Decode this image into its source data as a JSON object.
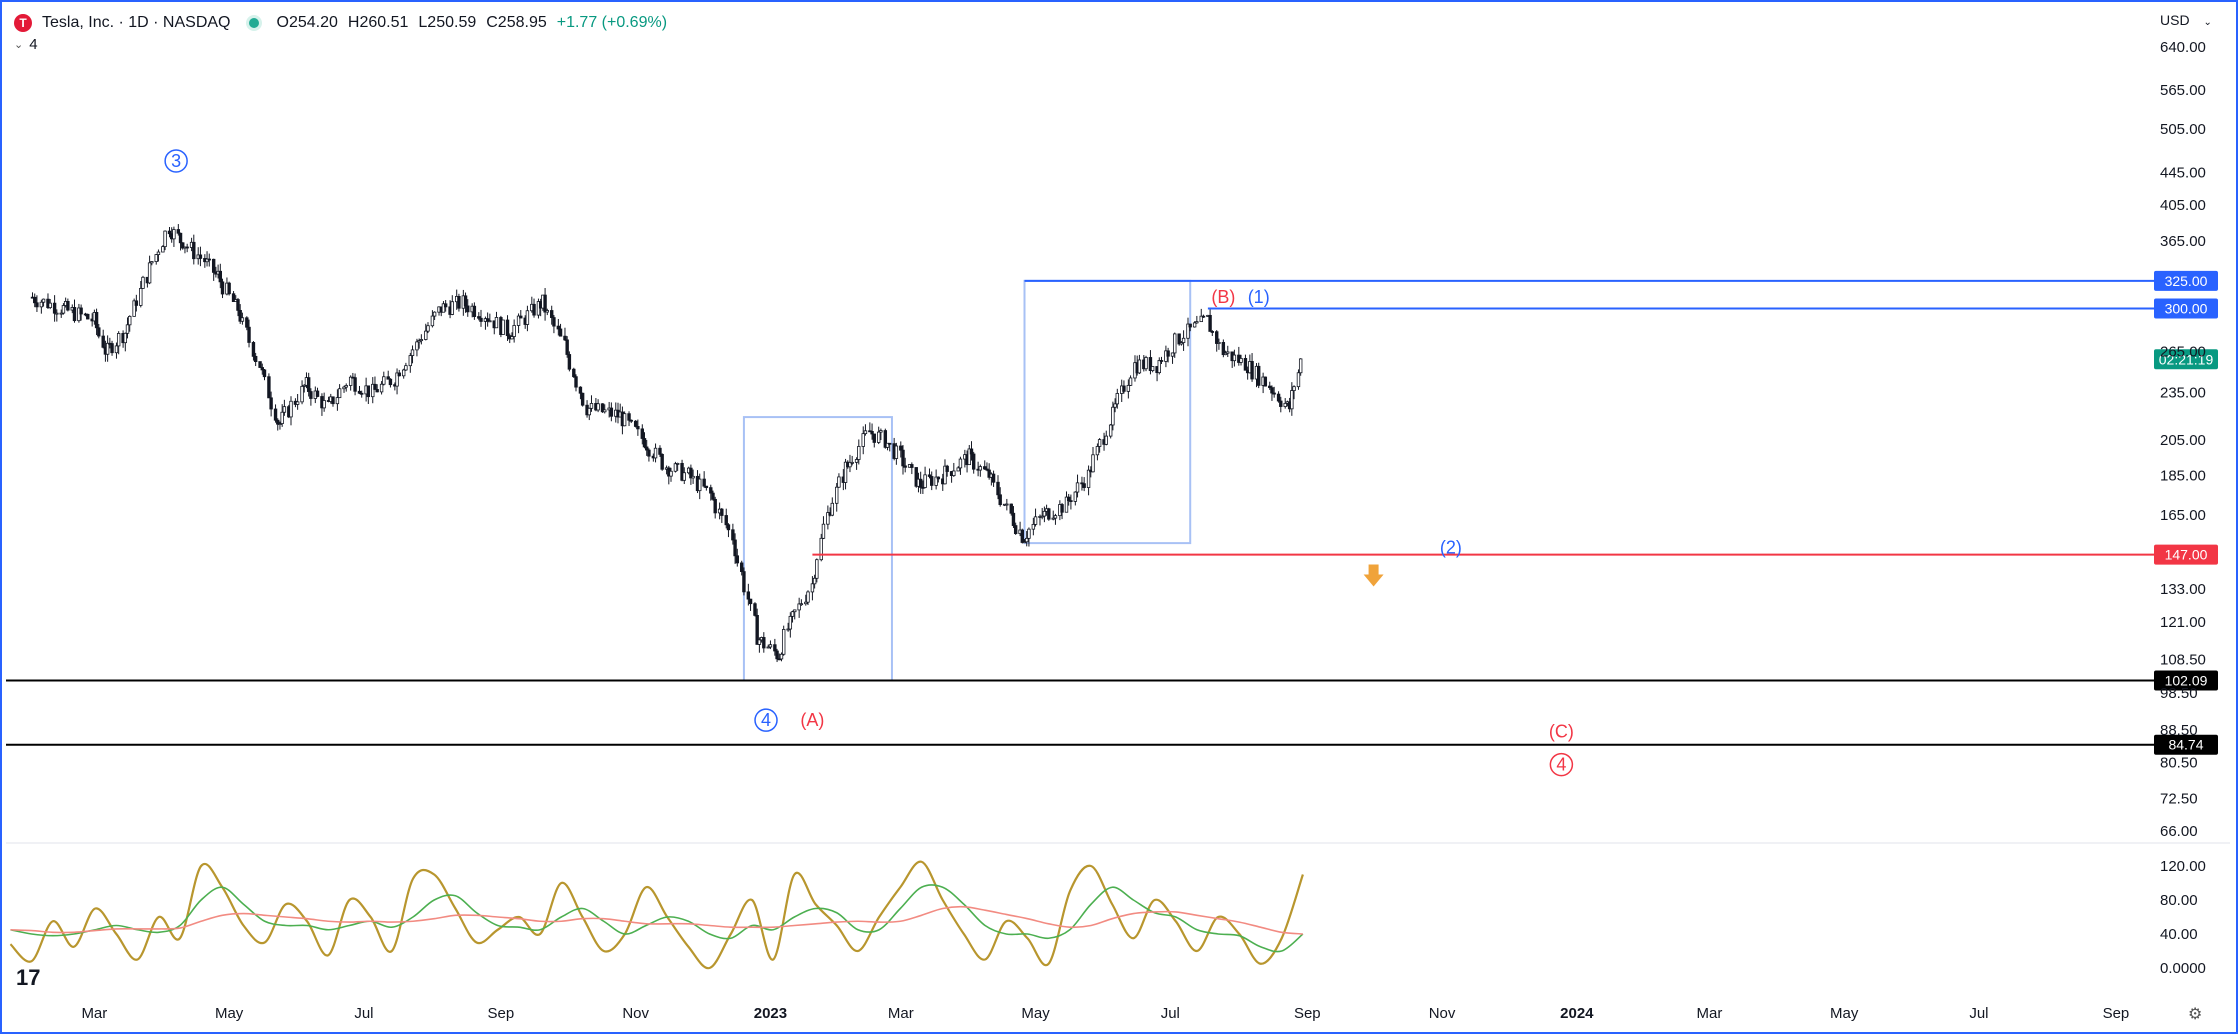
{
  "header": {
    "logo_letter": "T",
    "symbol_title": "Tesla, Inc. · 1D · NASDAQ",
    "open_label": "O",
    "open": "254.20",
    "high_label": "H",
    "high": "260.51",
    "low_label": "L",
    "low": "250.59",
    "close_label": "C",
    "close": "258.95",
    "change": "+1.77 (+0.69%)",
    "indicator_count": "4",
    "currency": "USD"
  },
  "colors": {
    "accent": "#2962ff",
    "up": "#089981",
    "down": "#f23645",
    "candle": "#131722",
    "fast_line": "#b8962e",
    "mid_line": "#4caf50",
    "slow_line": "#f28b82"
  },
  "chart_data": [
    {
      "type": "candlestick",
      "title": "Tesla, Inc. · 1D · NASDAQ",
      "y_scale": "log",
      "ylim": [
        62,
        700
      ],
      "y_ticks": [
        "640.00",
        "565.00",
        "505.00",
        "445.00",
        "405.00",
        "365.00",
        "265.00",
        "235.00",
        "205.00",
        "185.00",
        "165.00",
        "133.00",
        "121.00",
        "108.50",
        "98.50",
        "88.50",
        "80.50",
        "72.50",
        "66.00"
      ],
      "x_ticks": [
        "Mar",
        "May",
        "Jul",
        "Sep",
        "Nov",
        "2023",
        "Mar",
        "May",
        "Jul",
        "Sep",
        "Nov",
        "2024",
        "Mar",
        "May",
        "Jul",
        "Sep"
      ],
      "series": [
        {
          "date": "2022-02-01",
          "value": 310
        },
        {
          "date": "2022-02-15",
          "value": 300
        },
        {
          "date": "2022-03-01",
          "value": 290
        },
        {
          "date": "2022-03-07",
          "value": 265
        },
        {
          "date": "2022-03-15",
          "value": 280
        },
        {
          "date": "2022-03-25",
          "value": 330
        },
        {
          "date": "2022-04-04",
          "value": 380
        },
        {
          "date": "2022-04-10",
          "value": 365
        },
        {
          "date": "2022-04-20",
          "value": 345
        },
        {
          "date": "2022-04-26",
          "value": 330
        },
        {
          "date": "2022-05-05",
          "value": 300
        },
        {
          "date": "2022-05-15",
          "value": 255
        },
        {
          "date": "2022-05-24",
          "value": 215
        },
        {
          "date": "2022-06-05",
          "value": 240
        },
        {
          "date": "2022-06-15",
          "value": 225
        },
        {
          "date": "2022-06-25",
          "value": 245
        },
        {
          "date": "2022-07-05",
          "value": 235
        },
        {
          "date": "2022-07-15",
          "value": 245
        },
        {
          "date": "2022-07-25",
          "value": 270
        },
        {
          "date": "2022-08-05",
          "value": 300
        },
        {
          "date": "2022-08-15",
          "value": 305
        },
        {
          "date": "2022-08-25",
          "value": 295
        },
        {
          "date": "2022-09-05",
          "value": 280
        },
        {
          "date": "2022-09-20",
          "value": 305
        },
        {
          "date": "2022-09-30",
          "value": 270
        },
        {
          "date": "2022-10-10",
          "value": 225
        },
        {
          "date": "2022-10-25",
          "value": 220
        },
        {
          "date": "2022-11-05",
          "value": 205
        },
        {
          "date": "2022-11-15",
          "value": 190
        },
        {
          "date": "2022-11-25",
          "value": 185
        },
        {
          "date": "2022-12-05",
          "value": 175
        },
        {
          "date": "2022-12-15",
          "value": 155
        },
        {
          "date": "2022-12-27",
          "value": 115
        },
        {
          "date": "2023-01-05",
          "value": 110
        },
        {
          "date": "2023-01-10",
          "value": 120
        },
        {
          "date": "2023-01-20",
          "value": 135
        },
        {
          "date": "2023-01-27",
          "value": 165
        },
        {
          "date": "2023-02-05",
          "value": 190
        },
        {
          "date": "2023-02-15",
          "value": 210
        },
        {
          "date": "2023-02-22",
          "value": 205
        },
        {
          "date": "2023-03-01",
          "value": 195
        },
        {
          "date": "2023-03-10",
          "value": 180
        },
        {
          "date": "2023-03-20",
          "value": 185
        },
        {
          "date": "2023-04-01",
          "value": 195
        },
        {
          "date": "2023-04-10",
          "value": 185
        },
        {
          "date": "2023-04-20",
          "value": 165
        },
        {
          "date": "2023-04-26",
          "value": 155
        },
        {
          "date": "2023-05-05",
          "value": 165
        },
        {
          "date": "2023-05-15",
          "value": 170
        },
        {
          "date": "2023-05-25",
          "value": 185
        },
        {
          "date": "2023-06-05",
          "value": 220
        },
        {
          "date": "2023-06-15",
          "value": 255
        },
        {
          "date": "2023-06-25",
          "value": 255
        },
        {
          "date": "2023-07-05",
          "value": 275
        },
        {
          "date": "2023-07-18",
          "value": 290
        },
        {
          "date": "2023-07-25",
          "value": 265
        },
        {
          "date": "2023-08-05",
          "value": 255
        },
        {
          "date": "2023-08-15",
          "value": 240
        },
        {
          "date": "2023-08-24",
          "value": 225
        },
        {
          "date": "2023-08-30",
          "value": 258.95
        }
      ],
      "levels": [
        {
          "value": 325.0,
          "label": "325.00",
          "color": "#2962ff",
          "from": "2023-04-26"
        },
        {
          "value": 300.0,
          "label": "300.00",
          "color": "#2962ff",
          "from": "2023-07-18"
        },
        {
          "value": 147.0,
          "label": "147.00",
          "color": "#f23645",
          "from": "2023-01-20"
        },
        {
          "value": 102.09,
          "label": "102.09",
          "color": "#000000",
          "from": "2022-01-20"
        },
        {
          "value": 84.74,
          "label": "84.74",
          "color": "#000000",
          "from": "2022-01-20"
        }
      ],
      "countdown": "02:21:19",
      "boxes": [
        {
          "x0": "2022-12-20",
          "x1": "2023-02-25",
          "y0": 102.09,
          "y1": 219
        },
        {
          "x0": "2023-04-26",
          "x1": "2023-07-10",
          "y0": 152,
          "y1": 325
        }
      ],
      "annotations": [
        {
          "text": "3",
          "circled": true,
          "color": "#2962ff",
          "date": "2022-04-07",
          "value": 460
        },
        {
          "text": "4",
          "circled": true,
          "color": "#2962ff",
          "date": "2022-12-30",
          "value": 91
        },
        {
          "text": "(A)",
          "circled": false,
          "color": "#f23645",
          "date": "2023-01-20",
          "value": 91
        },
        {
          "text": "(B)",
          "circled": false,
          "color": "#f23645",
          "date": "2023-07-25",
          "value": 310
        },
        {
          "text": "(1)",
          "circled": false,
          "color": "#2962ff",
          "date": "2023-08-10",
          "value": 310
        },
        {
          "text": "(2)",
          "circled": false,
          "color": "#2962ff",
          "date": "2023-11-05",
          "value": 150
        },
        {
          "text": "(C)",
          "circled": false,
          "color": "#f23645",
          "date": "2023-12-25",
          "value": 88
        },
        {
          "text": "4",
          "circled": true,
          "color": "#f23645",
          "date": "2023-12-25",
          "value": 80
        }
      ],
      "arrow": {
        "date": "2023-10-01",
        "value": 138
      }
    },
    {
      "type": "line",
      "ylim": [
        -10,
        135
      ],
      "y_ticks": [
        "120.00",
        "80.00",
        "40.00",
        "0.0000"
      ],
      "series": [
        {
          "name": "",
          "color": "#b8962e",
          "values": [
            28,
            8,
            55,
            25,
            70,
            40,
            10,
            60,
            35,
            120,
            95,
            50,
            30,
            75,
            55,
            15,
            80,
            60,
            20,
            105,
            110,
            70,
            30,
            45,
            60,
            40,
            100,
            60,
            20,
            40,
            95,
            60,
            25,
            0,
            40,
            80,
            10,
            110,
            75,
            50,
            20,
            60,
            95,
            125,
            80,
            40,
            10,
            55,
            35,
            5,
            90,
            120,
            75,
            35,
            80,
            55,
            20,
            60,
            40,
            5,
            35,
            110
          ]
        },
        {
          "name": "",
          "color": "#4caf50",
          "values": [
            45,
            40,
            38,
            40,
            45,
            50,
            45,
            42,
            50,
            80,
            95,
            75,
            55,
            50,
            50,
            45,
            50,
            55,
            48,
            60,
            80,
            85,
            65,
            50,
            48,
            45,
            60,
            70,
            55,
            40,
            50,
            60,
            55,
            40,
            35,
            50,
            45,
            60,
            70,
            65,
            45,
            45,
            70,
            95,
            95,
            75,
            50,
            40,
            40,
            35,
            45,
            75,
            95,
            80,
            65,
            60,
            45,
            40,
            38,
            25,
            20,
            40
          ]
        },
        {
          "name": "",
          "color": "#f28b82",
          "values": [
            45,
            44,
            42,
            42,
            44,
            46,
            46,
            46,
            47,
            55,
            62,
            64,
            62,
            60,
            58,
            55,
            54,
            55,
            54,
            55,
            58,
            62,
            62,
            60,
            58,
            55,
            55,
            58,
            58,
            55,
            52,
            52,
            52,
            50,
            48,
            48,
            48,
            50,
            52,
            54,
            55,
            54,
            55,
            62,
            70,
            72,
            68,
            63,
            58,
            52,
            48,
            50,
            58,
            64,
            66,
            66,
            62,
            58,
            54,
            48,
            42,
            40
          ]
        }
      ]
    }
  ]
}
